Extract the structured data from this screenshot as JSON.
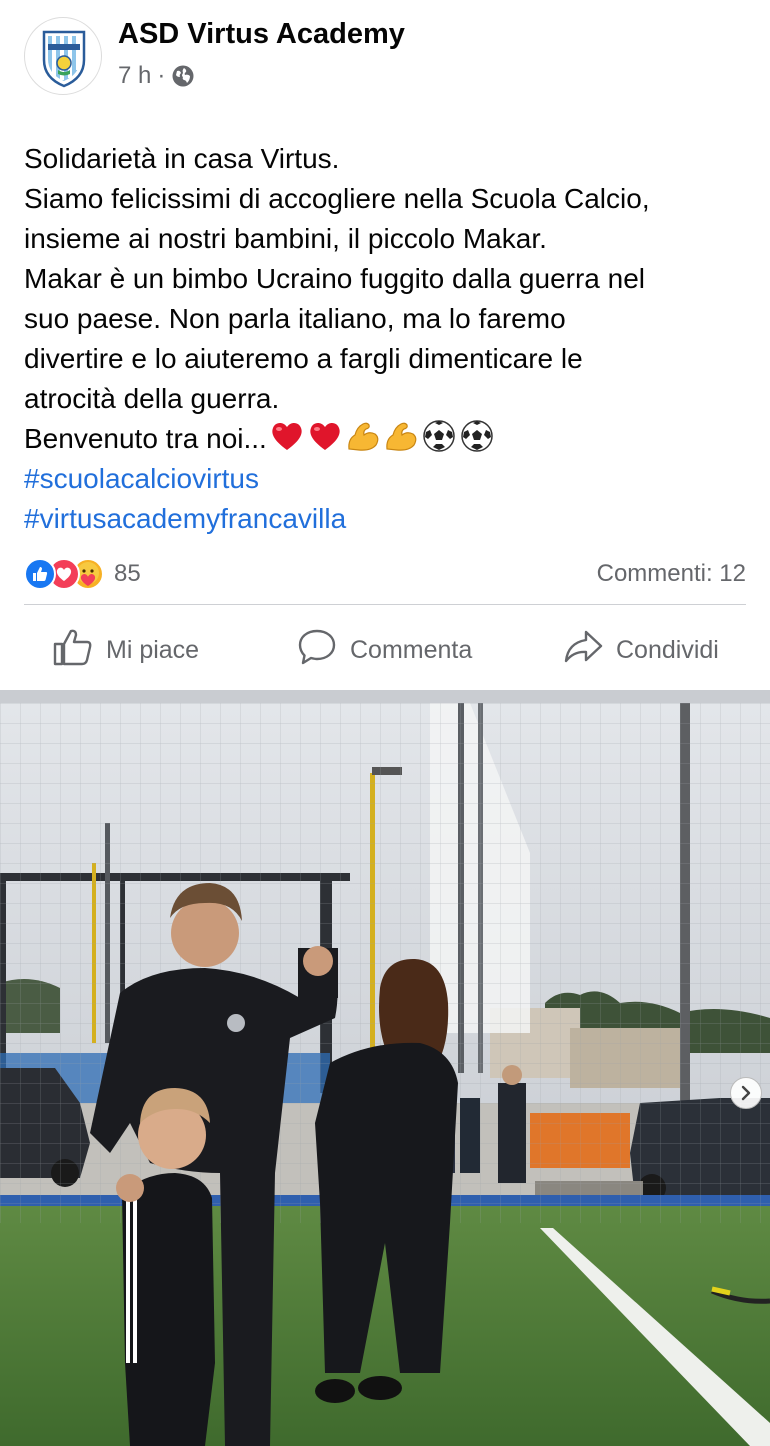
{
  "post": {
    "page_name": "ASD Virtus Academy",
    "time": "7 h",
    "separator": "·",
    "privacy_icon": "globe-icon",
    "text_lines": [
      "Solidarietà in casa Virtus.",
      "Siamo felicissimi di accogliere nella Scuola Calcio,",
      "insieme ai nostri bambini, il piccolo Makar.",
      "Makar è un bimbo Ucraino fuggito dalla guerra nel",
      "suo paese. Non parla italiano, ma lo faremo",
      "divertire e lo aiuteremo a fargli dimenticare le",
      "atrocità della guerra."
    ],
    "welcome_text": "Benvenuto tra noi...",
    "emojis": [
      "heart-emoji",
      "heart-emoji",
      "flexed-biceps-emoji",
      "flexed-biceps-emoji",
      "soccer-ball-emoji",
      "soccer-ball-emoji"
    ],
    "hashtags": [
      "#scuolacalciovirtus",
      "#virtusacademyfrancavilla"
    ]
  },
  "stats": {
    "reaction_icons": [
      "like-icon",
      "love-icon",
      "care-icon"
    ],
    "reaction_count": "85",
    "comments": "Commenti: 12"
  },
  "actions": {
    "like": "Mi piace",
    "comment": "Commenta",
    "share": "Condividi"
  },
  "photo": {
    "next_icon": "chevron-right-icon"
  },
  "colors": {
    "text": "#050505",
    "secondary": "#65676b",
    "hashtag": "#216fdb",
    "like_blue": "#1877f2",
    "love_red": "#f33e58",
    "care_yellow": "#f7b125"
  }
}
